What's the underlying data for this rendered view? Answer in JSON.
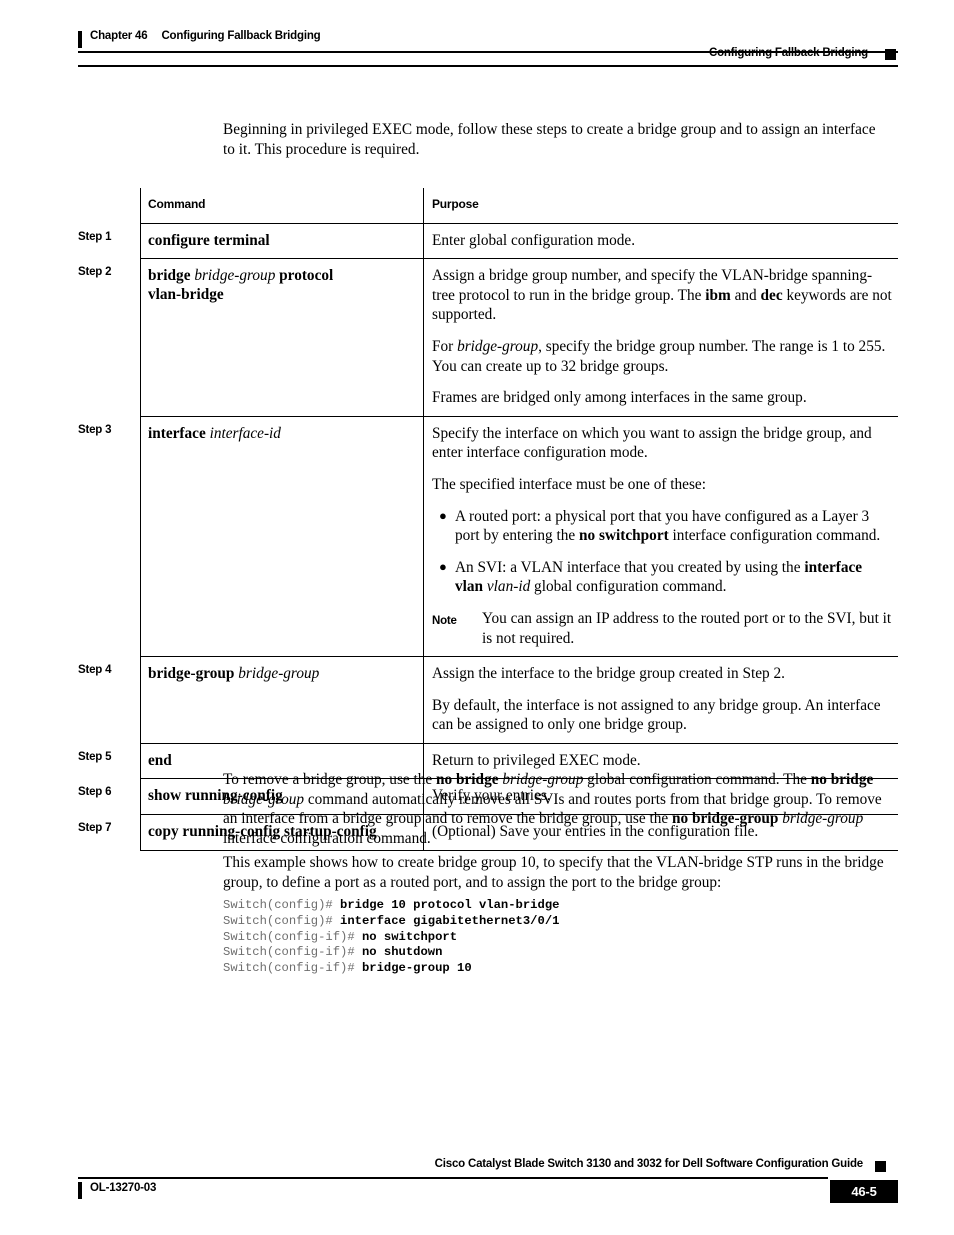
{
  "header": {
    "chapter_label": "Chapter 46",
    "chapter_title": "Configuring Fallback Bridging",
    "section_title": "Configuring Fallback Bridging"
  },
  "intro": {
    "paragraph": "Beginning in privileged EXEC mode, follow these steps to create a bridge group and to assign an interface to it. This procedure is required."
  },
  "table": {
    "col_command": "Command",
    "col_purpose": "Purpose",
    "steps": [
      {
        "step_label": "Step 1",
        "command_plain": "configure terminal",
        "purpose_plain": "Enter global configuration mode."
      },
      {
        "step_label": "Step 2",
        "command_plain": "bridge bridge-group protocol vlan-bridge",
        "purpose_p1": "Assign a bridge group number, and specify the VLAN-bridge spanning-tree protocol to run in the bridge group. The ibm and dec keywords are not supported.",
        "purpose_p2": "For bridge-group, specify the bridge group number. The range is 1 to 255. You can create up to 32 bridge groups.",
        "purpose_p3": "Frames are bridged only among interfaces in the same group."
      },
      {
        "step_label": "Step 3",
        "command_plain": "interface interface-id",
        "purpose_p1": "Specify the interface on which you want to assign the bridge group, and enter interface configuration mode.",
        "purpose_p2": "The specified interface must be one of these:",
        "bullet1": "A routed port: a physical port that you have configured as a Layer 3 port by entering the no switchport interface configuration command.",
        "bullet2": "An SVI: a VLAN interface that you created by using the interface vlan vlan-id global configuration command.",
        "note_label": "Note",
        "note_text": "You can assign an IP address to the routed port or to the SVI, but it is not required."
      },
      {
        "step_label": "Step 4",
        "command_plain": "bridge-group bridge-group",
        "purpose_p1": "Assign the interface to the bridge group created in Step 2.",
        "purpose_p2": "By default, the interface is not assigned to any bridge group. An interface can be assigned to only one bridge group."
      },
      {
        "step_label": "Step 5",
        "command_plain": "end",
        "purpose_plain": "Return to privileged EXEC mode."
      },
      {
        "step_label": "Step 6",
        "command_plain": "show running-config",
        "purpose_plain": "Verify your entries."
      },
      {
        "step_label": "Step 7",
        "command_plain": "copy running-config startup-config",
        "purpose_plain": "(Optional) Save your entries in the configuration file."
      }
    ]
  },
  "body": {
    "remove_paragraph": "To remove a bridge group, use the no bridge bridge-group global configuration command. The no bridge bridge-group command automatically removes all SVIs and routes ports from that bridge group. To remove an interface from a bridge group and to remove the bridge group, use the no bridge-group bridge-group interface configuration command.",
    "example_paragraph": "This example shows how to create bridge group 10, to specify that the VLAN-bridge STP runs in the bridge group, to define a port as a routed port, and to assign the port to the bridge group:"
  },
  "code": {
    "lines": [
      {
        "prompt": "Switch(config)# ",
        "command": "bridge 10 protocol vlan-bridge"
      },
      {
        "prompt": "Switch(config)# ",
        "command": "interface gigabitethernet3/0/1"
      },
      {
        "prompt": "Switch(config-if)# ",
        "command": "no switchport"
      },
      {
        "prompt": "Switch(config-if)# ",
        "command": "no shutdown"
      },
      {
        "prompt": "Switch(config-if)# ",
        "command": "bridge-group 10"
      }
    ]
  },
  "footer": {
    "guide_title": "Cisco Catalyst Blade Switch 3130 and 3032 for Dell Software Configuration Guide",
    "doc_number": "OL-13270-03",
    "page_number": "46-5"
  }
}
